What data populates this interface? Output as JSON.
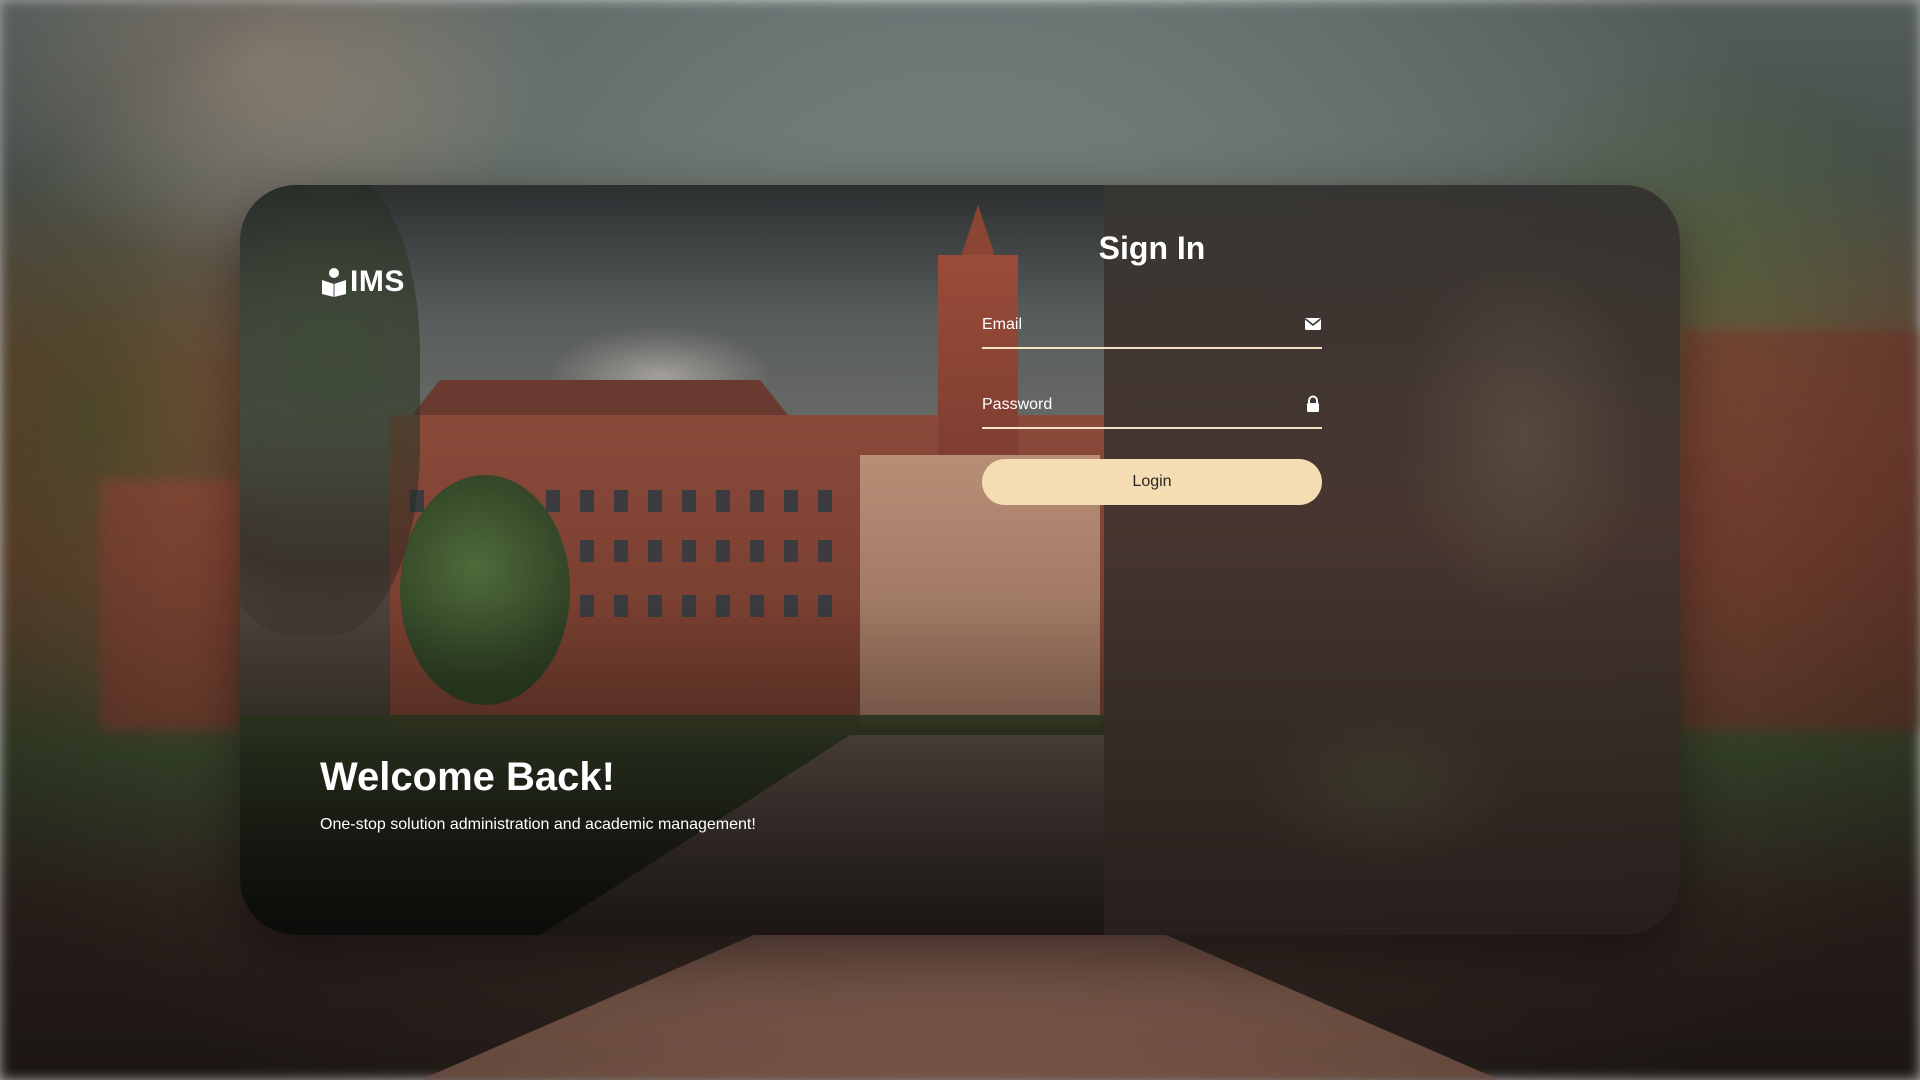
{
  "brand": {
    "name": "IMS",
    "logo_icon": "book-reader-icon"
  },
  "hero": {
    "title": "Welcome Back!",
    "subtitle": "One-stop solution administration and academic management!"
  },
  "signin": {
    "title": "Sign In",
    "email_placeholder": "Email",
    "email_icon": "envelope-icon",
    "password_placeholder": "Password",
    "password_icon": "lock-icon",
    "login_label": "Login"
  },
  "colors": {
    "accent": "#f5ddb3",
    "text": "#ffffff",
    "button_text": "#2b2622"
  }
}
